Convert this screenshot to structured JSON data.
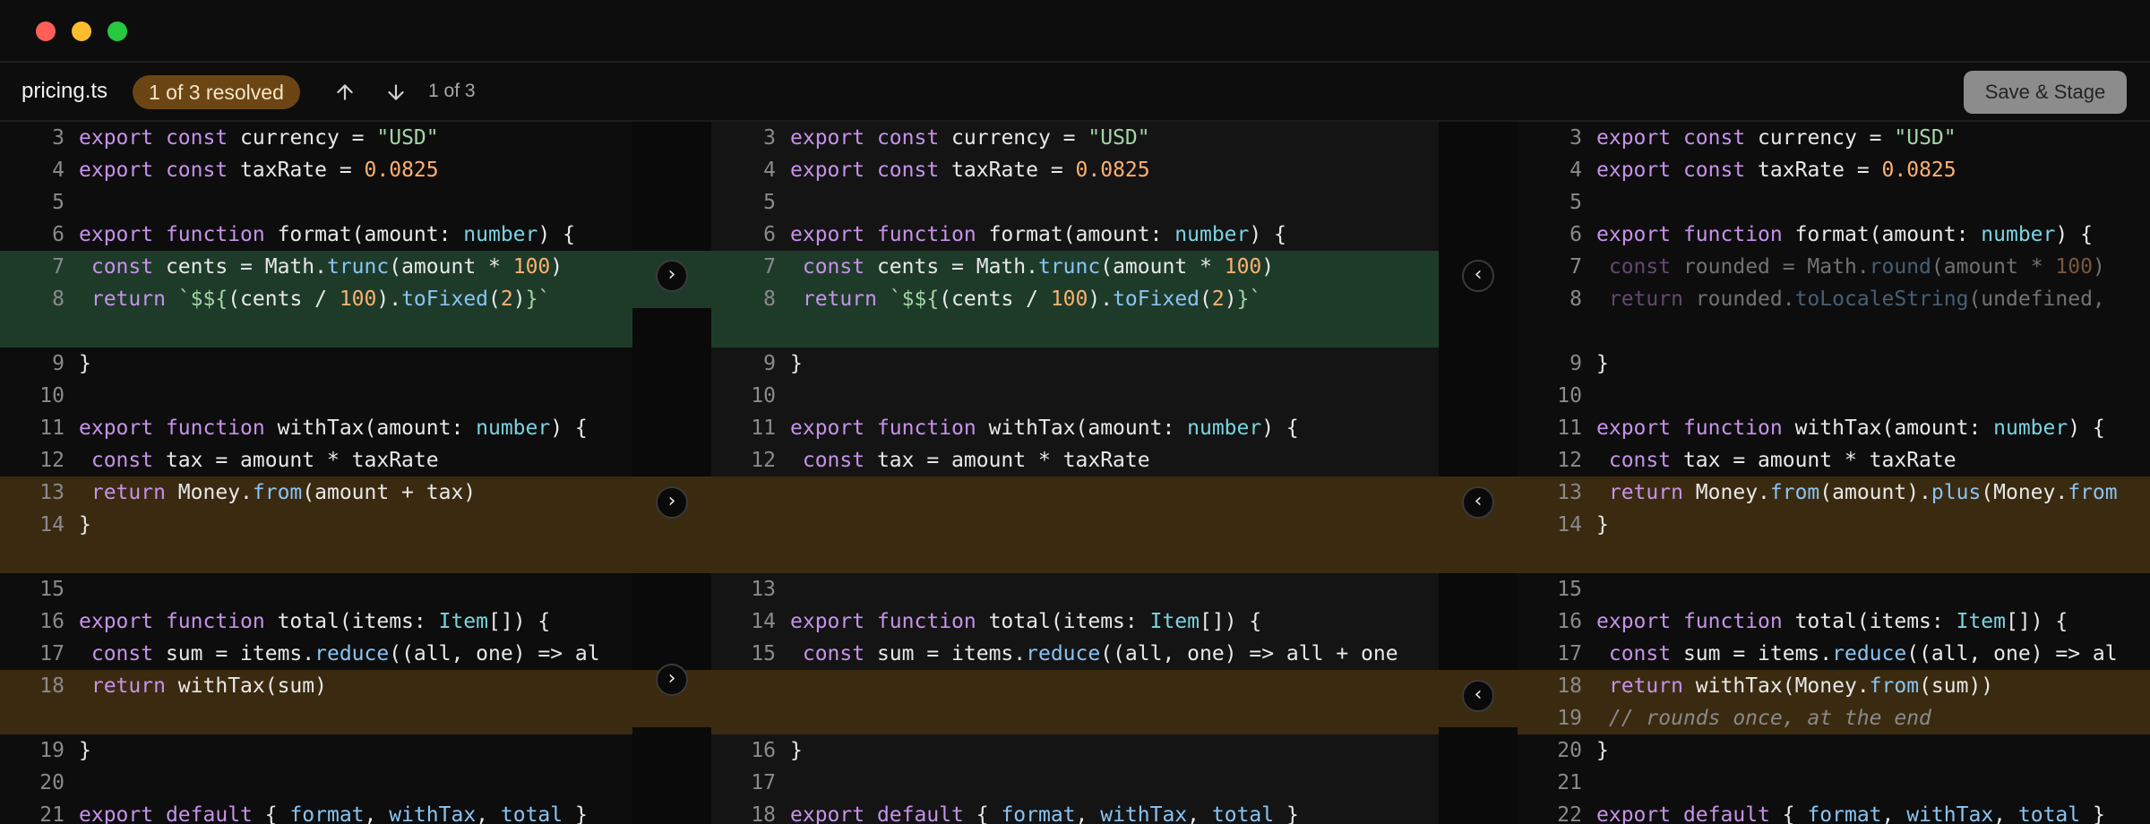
{
  "toolbar": {
    "filename": "pricing.ts",
    "status_badge": "1 of 3 resolved",
    "counter": "1 of 3",
    "save_label": "Save & Stage"
  },
  "icons": {
    "prev_conflict": "arrow-up-icon",
    "next_conflict": "arrow-down-icon",
    "accept_right": "chevron-right",
    "accept_left": "chevron-left"
  },
  "colors": {
    "resolved": "#1e3b2a",
    "conflict": "#3a2a10",
    "badge": "#6b4614"
  },
  "buttons": {
    "take_left": "›",
    "take_right": "‹"
  },
  "panes": {
    "left": [
      {
        "n": "3",
        "code": [
          [
            "k",
            "export"
          ],
          [
            "",
            "."
          ],
          [
            "k",
            "const"
          ],
          [
            "",
            " currency = "
          ],
          [
            "s",
            "\"USD\""
          ]
        ]
      },
      {
        "n": "4",
        "code": [
          [
            "k",
            "export"
          ],
          [
            "",
            " "
          ],
          [
            "k",
            "const"
          ],
          [
            "",
            " taxRate = "
          ],
          [
            "n",
            "0.0825"
          ]
        ]
      },
      {
        "n": "5",
        "code": []
      },
      {
        "n": "6",
        "code": [
          [
            "k",
            "export"
          ],
          [
            "",
            " "
          ],
          [
            "k",
            "function"
          ],
          [
            "",
            " format(amount: "
          ],
          [
            "t",
            "number"
          ],
          [
            "",
            ") {"
          ]
        ]
      },
      {
        "n": "7",
        "code": [
          [
            "",
            " "
          ],
          [
            "k",
            "const"
          ],
          [
            "",
            " cents = Math."
          ],
          [
            "f",
            "trunc"
          ],
          [
            "",
            "(amount * "
          ],
          [
            "n",
            "100"
          ],
          [
            "",
            ")"
          ]
        ]
      },
      {
        "n": "8",
        "code": [
          [
            "",
            " "
          ],
          [
            "k",
            "return"
          ],
          [
            "",
            " "
          ],
          [
            "s",
            "`$${"
          ],
          [
            "",
            "(cents / "
          ],
          [
            "n",
            "100"
          ],
          [
            "",
            ")."
          ],
          [
            "f",
            "toFixed"
          ],
          [
            "",
            "("
          ],
          [
            "n",
            "2"
          ],
          [
            "",
            ")"
          ],
          [
            "s",
            "}`"
          ]
        ]
      },
      {
        "n": "",
        "code": []
      },
      {
        "n": "9",
        "code": [
          [
            "",
            "}"
          ]
        ]
      },
      {
        "n": "10",
        "code": []
      },
      {
        "n": "11",
        "code": [
          [
            "k",
            "export"
          ],
          [
            "",
            " "
          ],
          [
            "k",
            "function"
          ],
          [
            "",
            " withTax(amount: "
          ],
          [
            "t",
            "number"
          ],
          [
            "",
            ") {"
          ]
        ]
      },
      {
        "n": "12",
        "code": [
          [
            "",
            " "
          ],
          [
            "k",
            "const"
          ],
          [
            "",
            " tax = amount * taxRate"
          ]
        ]
      },
      {
        "n": "13",
        "code": [
          [
            "",
            " "
          ],
          [
            "k",
            "return"
          ],
          [
            "",
            " Money."
          ],
          [
            "f",
            "from"
          ],
          [
            "",
            "(amount + tax)"
          ]
        ]
      },
      {
        "n": "14",
        "code": [
          [
            "",
            "}"
          ]
        ]
      },
      {
        "n": "",
        "code": []
      },
      {
        "n": "15",
        "code": []
      },
      {
        "n": "16",
        "code": [
          [
            "k",
            "export"
          ],
          [
            "",
            " "
          ],
          [
            "k",
            "function"
          ],
          [
            "",
            " total(items: "
          ],
          [
            "t",
            "Item"
          ],
          [
            "",
            "[]) {"
          ]
        ]
      },
      {
        "n": "17",
        "code": [
          [
            "",
            " "
          ],
          [
            "k",
            "const"
          ],
          [
            "",
            " sum = items."
          ],
          [
            "f",
            "reduce"
          ],
          [
            "",
            "((all, one) => al"
          ]
        ]
      },
      {
        "n": "18",
        "code": [
          [
            "",
            " "
          ],
          [
            "k",
            "return"
          ],
          [
            "",
            " withTax(sum)"
          ]
        ]
      },
      {
        "n": "",
        "code": []
      },
      {
        "n": "19",
        "code": [
          [
            "",
            "}"
          ]
        ]
      },
      {
        "n": "20",
        "code": []
      },
      {
        "n": "21",
        "code": [
          [
            "k",
            "export"
          ],
          [
            "",
            " "
          ],
          [
            "k",
            "default"
          ],
          [
            "",
            " { "
          ],
          [
            "f",
            "format"
          ],
          [
            "",
            ", "
          ],
          [
            "f",
            "withTax"
          ],
          [
            "",
            ", "
          ],
          [
            "f",
            "total"
          ],
          [
            "",
            " }"
          ]
        ]
      }
    ],
    "mid": [
      {
        "n": "3",
        "code": [
          [
            "k",
            "export"
          ],
          [
            "",
            " "
          ],
          [
            "k",
            "const"
          ],
          [
            "",
            " currency = "
          ],
          [
            "s",
            "\"USD\""
          ]
        ]
      },
      {
        "n": "4",
        "code": [
          [
            "k",
            "export"
          ],
          [
            "",
            " "
          ],
          [
            "k",
            "const"
          ],
          [
            "",
            " taxRate = "
          ],
          [
            "n",
            "0.0825"
          ]
        ]
      },
      {
        "n": "5",
        "code": []
      },
      {
        "n": "6",
        "code": [
          [
            "k",
            "export"
          ],
          [
            "",
            " "
          ],
          [
            "k",
            "function"
          ],
          [
            "",
            " format(amount: "
          ],
          [
            "t",
            "number"
          ],
          [
            "",
            ") {"
          ]
        ]
      },
      {
        "n": "7",
        "code": [
          [
            "",
            " "
          ],
          [
            "k",
            "const"
          ],
          [
            "",
            " cents = Math."
          ],
          [
            "f",
            "trunc"
          ],
          [
            "",
            "(amount * "
          ],
          [
            "n",
            "100"
          ],
          [
            "",
            ")"
          ]
        ]
      },
      {
        "n": "8",
        "code": [
          [
            "",
            " "
          ],
          [
            "k",
            "return"
          ],
          [
            "",
            " "
          ],
          [
            "s",
            "`$${"
          ],
          [
            "",
            "(cents / "
          ],
          [
            "n",
            "100"
          ],
          [
            "",
            ")."
          ],
          [
            "f",
            "toFixed"
          ],
          [
            "",
            "("
          ],
          [
            "n",
            "2"
          ],
          [
            "",
            ")"
          ],
          [
            "s",
            "}`"
          ]
        ]
      },
      {
        "n": "",
        "code": []
      },
      {
        "n": "9",
        "code": [
          [
            "",
            "}"
          ]
        ]
      },
      {
        "n": "10",
        "code": []
      },
      {
        "n": "11",
        "code": [
          [
            "k",
            "export"
          ],
          [
            "",
            " "
          ],
          [
            "k",
            "function"
          ],
          [
            "",
            " withTax(amount: "
          ],
          [
            "t",
            "number"
          ],
          [
            "",
            ") {"
          ]
        ]
      },
      {
        "n": "12",
        "code": [
          [
            "",
            " "
          ],
          [
            "k",
            "const"
          ],
          [
            "",
            " tax = amount * taxRate"
          ]
        ]
      },
      {
        "n": "",
        "code": []
      },
      {
        "n": "",
        "code": []
      },
      {
        "n": "",
        "code": []
      },
      {
        "n": "13",
        "code": []
      },
      {
        "n": "14",
        "code": [
          [
            "k",
            "export"
          ],
          [
            "",
            " "
          ],
          [
            "k",
            "function"
          ],
          [
            "",
            " total(items: "
          ],
          [
            "t",
            "Item"
          ],
          [
            "",
            "[]) {"
          ]
        ]
      },
      {
        "n": "15",
        "code": [
          [
            "",
            " "
          ],
          [
            "k",
            "const"
          ],
          [
            "",
            " sum = items."
          ],
          [
            "f",
            "reduce"
          ],
          [
            "",
            "((all, one) => all + one"
          ]
        ]
      },
      {
        "n": "",
        "code": []
      },
      {
        "n": "",
        "code": []
      },
      {
        "n": "16",
        "code": [
          [
            "",
            "}"
          ]
        ]
      },
      {
        "n": "17",
        "code": []
      },
      {
        "n": "18",
        "code": [
          [
            "k",
            "export"
          ],
          [
            "",
            " "
          ],
          [
            "k",
            "default"
          ],
          [
            "",
            " { "
          ],
          [
            "f",
            "format"
          ],
          [
            "",
            ", "
          ],
          [
            "f",
            "withTax"
          ],
          [
            "",
            ", "
          ],
          [
            "f",
            "total"
          ],
          [
            "",
            " }"
          ]
        ]
      }
    ],
    "right": [
      {
        "n": "3",
        "code": [
          [
            "k",
            "export"
          ],
          [
            "",
            " "
          ],
          [
            "k",
            "const"
          ],
          [
            "",
            " currency = "
          ],
          [
            "s",
            "\"USD\""
          ]
        ]
      },
      {
        "n": "4",
        "code": [
          [
            "k",
            "export"
          ],
          [
            "",
            " "
          ],
          [
            "k",
            "const"
          ],
          [
            "",
            " taxRate = "
          ],
          [
            "n",
            "0.0825"
          ]
        ]
      },
      {
        "n": "5",
        "code": []
      },
      {
        "n": "6",
        "code": [
          [
            "k",
            "export"
          ],
          [
            "",
            " "
          ],
          [
            "k",
            "function"
          ],
          [
            "",
            " format(amount: "
          ],
          [
            "t",
            "number"
          ],
          [
            "",
            ") {"
          ]
        ]
      },
      {
        "n": "7",
        "dim": true,
        "code": [
          [
            "",
            " "
          ],
          [
            "k",
            "const"
          ],
          [
            "",
            " rounded = Math."
          ],
          [
            "f",
            "round"
          ],
          [
            "",
            "(amount * "
          ],
          [
            "n",
            "100"
          ],
          [
            "",
            ")"
          ]
        ]
      },
      {
        "n": "8",
        "dim": true,
        "code": [
          [
            "",
            " "
          ],
          [
            "k",
            "return"
          ],
          [
            "",
            " rounded."
          ],
          [
            "f",
            "toLocaleString"
          ],
          [
            "",
            "(undefined,"
          ]
        ]
      },
      {
        "n": "",
        "code": []
      },
      {
        "n": "9",
        "code": [
          [
            "",
            "}"
          ]
        ]
      },
      {
        "n": "10",
        "code": []
      },
      {
        "n": "11",
        "code": [
          [
            "k",
            "export"
          ],
          [
            "",
            " "
          ],
          [
            "k",
            "function"
          ],
          [
            "",
            " withTax(amount: "
          ],
          [
            "t",
            "number"
          ],
          [
            "",
            ") {"
          ]
        ]
      },
      {
        "n": "12",
        "code": [
          [
            "",
            " "
          ],
          [
            "k",
            "const"
          ],
          [
            "",
            " tax = amount * taxRate"
          ]
        ]
      },
      {
        "n": "13",
        "code": [
          [
            "",
            " "
          ],
          [
            "k",
            "return"
          ],
          [
            "",
            " Money."
          ],
          [
            "f",
            "from"
          ],
          [
            "",
            "(amount)."
          ],
          [
            "f",
            "plus"
          ],
          [
            "",
            "(Money."
          ],
          [
            "f",
            "from"
          ]
        ]
      },
      {
        "n": "14",
        "code": [
          [
            "",
            "}"
          ]
        ]
      },
      {
        "n": "",
        "code": []
      },
      {
        "n": "15",
        "code": []
      },
      {
        "n": "16",
        "code": [
          [
            "k",
            "export"
          ],
          [
            "",
            " "
          ],
          [
            "k",
            "function"
          ],
          [
            "",
            " total(items: "
          ],
          [
            "t",
            "Item"
          ],
          [
            "",
            "[]) {"
          ]
        ]
      },
      {
        "n": "17",
        "code": [
          [
            "",
            " "
          ],
          [
            "k",
            "const"
          ],
          [
            "",
            " sum = items."
          ],
          [
            "f",
            "reduce"
          ],
          [
            "",
            "((all, one) => al"
          ]
        ]
      },
      {
        "n": "18",
        "code": [
          [
            "",
            " "
          ],
          [
            "k",
            "return"
          ],
          [
            "",
            " withTax(Money."
          ],
          [
            "f",
            "from"
          ],
          [
            "",
            "(sum))"
          ]
        ]
      },
      {
        "n": "19",
        "code": [
          [
            "",
            " "
          ],
          [
            "c",
            "// rounds once, at the end"
          ]
        ]
      },
      {
        "n": "20",
        "code": [
          [
            "",
            "}"
          ]
        ]
      },
      {
        "n": "21",
        "code": []
      },
      {
        "n": "22",
        "code": [
          [
            "k",
            "export"
          ],
          [
            "",
            " "
          ],
          [
            "k",
            "default"
          ],
          [
            "",
            " { "
          ],
          [
            "f",
            "format"
          ],
          [
            "",
            ", "
          ],
          [
            "f",
            "withTax"
          ],
          [
            "",
            ", "
          ],
          [
            "f",
            "total"
          ],
          [
            "",
            " }"
          ]
        ]
      }
    ]
  }
}
